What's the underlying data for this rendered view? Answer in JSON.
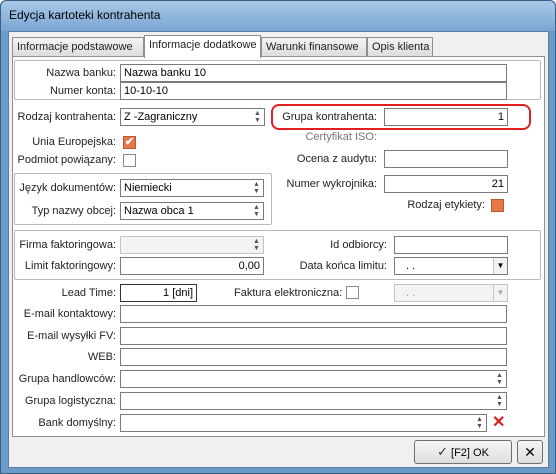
{
  "window": {
    "title": "Edycja kartoteki kontrahenta"
  },
  "tabs": [
    {
      "label": "Informacje podstawowe"
    },
    {
      "label": "Informacje dodatkowe"
    },
    {
      "label": "Warunki finansowe"
    },
    {
      "label": "Opis klienta"
    }
  ],
  "bank": {
    "name_label": "Nazwa banku:",
    "name_value": "Nazwa banku 10",
    "account_label": "Numer konta:",
    "account_value": "10-10-10"
  },
  "contractor": {
    "type_label": "Rodzaj kontrahenta:",
    "type_value": "Z -Zagraniczny",
    "eu_label": "Unia Europejska:",
    "eu_checked": "✔",
    "related_label": "Podmiot powiązany:",
    "group_label": "Grupa kontrahenta:",
    "group_value": "1",
    "iso_label": "Certyfikat ISO:",
    "audit_label": "Ocena z audytu:",
    "pattern_label": "Numer wykrojnika:",
    "pattern_value": "21",
    "label_type_label": "Rodzaj etykiety:"
  },
  "language": {
    "doc_lang_label": "Język dokumentów:",
    "doc_lang_value": "Niemiecki",
    "foreign_name_type_label": "Typ nazwy obcej:",
    "foreign_name_type_value": "Nazwa obca 1"
  },
  "factoring": {
    "company_label": "Firma faktoringowa:",
    "limit_label": "Limit faktoringowy:",
    "limit_value": "0,00",
    "recipient_id_label": "Id odbiorcy:",
    "limit_end_label": "Data końca limitu:",
    "limit_end_value": ". ."
  },
  "misc": {
    "lead_time_label": "Lead Time:",
    "lead_time_value": "1 [dni]",
    "einvoice_label": "Faktura elektroniczna:",
    "einvoice_date_value": ". .",
    "email_contact_label": "E-mail kontaktowy:",
    "email_invoice_label": "E-mail wysyłki FV:",
    "web_label": "WEB:",
    "sales_group_label": "Grupa handlowców:",
    "logistic_group_label": "Grupa logistyczna:",
    "default_bank_label": "Bank domyślny:"
  },
  "buttons": {
    "ok_label": "[F2] OK"
  },
  "colors": {
    "highlight": "#e02020",
    "checkbox_orange": "#e8784a"
  }
}
